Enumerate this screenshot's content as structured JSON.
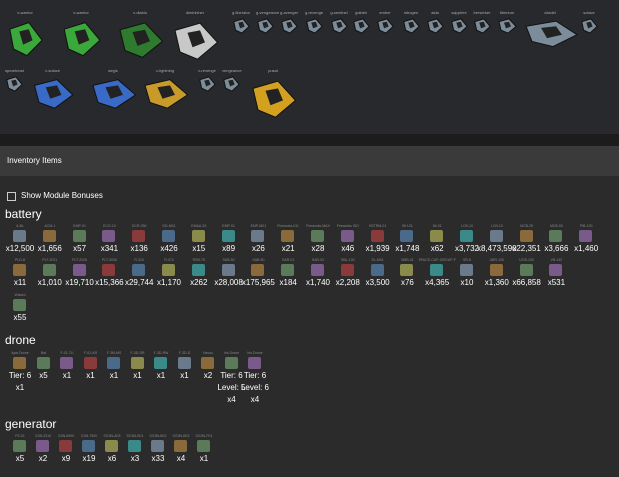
{
  "colors": {
    "bg": "#2b2b2b",
    "header_bg": "#3a3a3a",
    "ship_strip_bg": "#27292c",
    "tier": "#e8a23a",
    "level": "#35d0e8"
  },
  "ships": {
    "row1": [
      {
        "name": "v-warrior",
        "color": "#3aa83a"
      },
      {
        "name": "v-warrior",
        "color": "#3aa83a"
      },
      {
        "name": "v-diablo",
        "color": "#2e7a2e"
      },
      {
        "name": "diminisher",
        "color": "#c8c8c8"
      },
      {
        "name": "g-liberator",
        "color": "#7c8c9a"
      },
      {
        "name": "g-vengeance",
        "color": "#7c8c9a"
      },
      {
        "name": "g-avenger",
        "color": "#7c8c9a"
      },
      {
        "name": "g-revenge",
        "color": "#7c8c9a"
      },
      {
        "name": "g-sentinel",
        "color": "#7c8c9a"
      },
      {
        "name": "goliath",
        "color": "#7c8c9a"
      },
      {
        "name": "ember",
        "color": "#7c8c9a"
      },
      {
        "name": "nitrogen",
        "color": "#7c8c9a"
      },
      {
        "name": "aida",
        "color": "#7c8c9a"
      },
      {
        "name": "sapphire",
        "color": "#7c8c9a"
      },
      {
        "name": "berserker",
        "color": "#7c8c9a"
      },
      {
        "name": "tiberium",
        "color": "#7c8c9a"
      },
      {
        "name": "citadel",
        "color": "#7c8c9a"
      },
      {
        "name": "solace",
        "color": "#7c8c9a"
      }
    ],
    "row2": [
      {
        "name": "spearhead",
        "color": "#7c8c9a"
      },
      {
        "name": "v-solace",
        "color": "#3a6ac8"
      },
      {
        "name": "aegis",
        "color": "#3a6ac8"
      },
      {
        "name": "v-lightning",
        "color": "#c89a2a"
      },
      {
        "name": "v-revenge",
        "color": "#7c8c9a"
      },
      {
        "name": "vengeance",
        "color": "#7c8c9a"
      },
      {
        "name": "pusat",
        "color": "#d4a020"
      }
    ]
  },
  "inventory": {
    "title": "Inventory Items",
    "show_module_bonuses": "Show Module Bonuses"
  },
  "categories": [
    {
      "name": "battery",
      "rows": [
        [
          {
            "label": "A-BL",
            "count": "x12,500"
          },
          {
            "label": "ACM-1",
            "count": "x1,656"
          },
          {
            "label": "EMP-01",
            "count": "x57"
          },
          {
            "label": "ECO-10",
            "count": "x341"
          },
          {
            "label": "DCR-250",
            "count": "x136"
          },
          {
            "label": "DD-M01",
            "count": "x426"
          },
          {
            "label": "EMAA-20",
            "count": "x15"
          },
          {
            "label": "EMP-01",
            "count": "x89"
          },
          {
            "label": "EMP-M01",
            "count": "x26"
          },
          {
            "label": "Fireworks IGL",
            "count": "x21"
          },
          {
            "label": "Fireworks MAX",
            "count": "x28"
          },
          {
            "label": "Fireworks ISO",
            "count": "x46"
          },
          {
            "label": "HSTRM-01",
            "count": "x1,939"
          },
          {
            "label": "ISH-01",
            "count": "x1,748"
          },
          {
            "label": "IM-01",
            "count": "x62"
          },
          {
            "label": "LCB-10",
            "count": "x3,732"
          },
          {
            "label": "LCB-10",
            "count": "x8,473,590"
          },
          {
            "label": "MCB-25",
            "count": "x22,351"
          },
          {
            "label": "MCB-50",
            "count": "x3,666"
          },
          {
            "label": "PIB-100",
            "count": "x1,460"
          }
        ],
        [
          {
            "label": "PLD-8",
            "count": "x11"
          },
          {
            "label": "PLT-2021",
            "count": "x1,010"
          },
          {
            "label": "PLT-2026",
            "count": "x19,710"
          },
          {
            "label": "PLT-3030",
            "count": "x15,366"
          },
          {
            "label": "R-310",
            "count": "x29,744"
          },
          {
            "label": "R-IC3",
            "count": "x1,170"
          },
          {
            "label": "RSB-75",
            "count": "x262"
          },
          {
            "label": "SAB-50",
            "count": "x28,008"
          },
          {
            "label": "SAB-50",
            "count": "x175,965"
          },
          {
            "label": "SAR-01",
            "count": "x184"
          },
          {
            "label": "SAR-02",
            "count": "x1,740"
          },
          {
            "label": "SBL-100",
            "count": "x2,208"
          },
          {
            "label": "SL-M01",
            "count": "x3,500"
          },
          {
            "label": "SMB-01",
            "count": "x76"
          },
          {
            "label": "SPACE-CUP-GROUP-F",
            "count": "x4,365"
          },
          {
            "label": "SR-5",
            "count": "x10"
          },
          {
            "label": "UBR-100",
            "count": "x1,360"
          },
          {
            "label": "UCB-100",
            "count": "x66,858"
          },
          {
            "label": "VB-142",
            "count": "x531"
          }
        ],
        [
          {
            "label": "Wizard",
            "count": "x55"
          }
        ]
      ]
    },
    {
      "name": "drone",
      "rows": [
        [
          {
            "label": "Apis Drone",
            "tier": "Tier: 6",
            "count": "x1"
          },
          {
            "label": "Bat",
            "count": "x5"
          },
          {
            "label": "F-01-TU",
            "count": "x1"
          },
          {
            "label": "F-02-AR",
            "count": "x1"
          },
          {
            "label": "F-3M-MS",
            "count": "x1"
          },
          {
            "label": "F-3D-DR",
            "count": "x1"
          },
          {
            "label": "F-3D-RW",
            "count": "x1"
          },
          {
            "label": "F-3D-D",
            "count": "x1"
          },
          {
            "label": "Havoc",
            "count": "x2"
          },
          {
            "label": "Iris Drone",
            "tier": "Tier: 6",
            "level": "Level: 5",
            "count": "x4"
          },
          {
            "label": "Iris Drone",
            "tier": "Tier: 6",
            "level": "Level: 6",
            "count": "x4"
          }
        ]
      ]
    },
    {
      "name": "generator",
      "rows": [
        [
          {
            "label": "FS-01",
            "count": "x5"
          },
          {
            "label": "G3N-3310",
            "count": "x2"
          },
          {
            "label": "G3N-6900",
            "count": "x9"
          },
          {
            "label": "G3N-7900",
            "count": "x19"
          },
          {
            "label": "SG3N-A03",
            "count": "x6"
          },
          {
            "label": "SG3N-B01",
            "count": "x3"
          },
          {
            "label": "SG3N-B02",
            "count": "x33"
          },
          {
            "label": "SG3N-B03",
            "count": "x4"
          },
          {
            "label": "SG3N-P01",
            "count": "x1"
          }
        ]
      ]
    }
  ]
}
